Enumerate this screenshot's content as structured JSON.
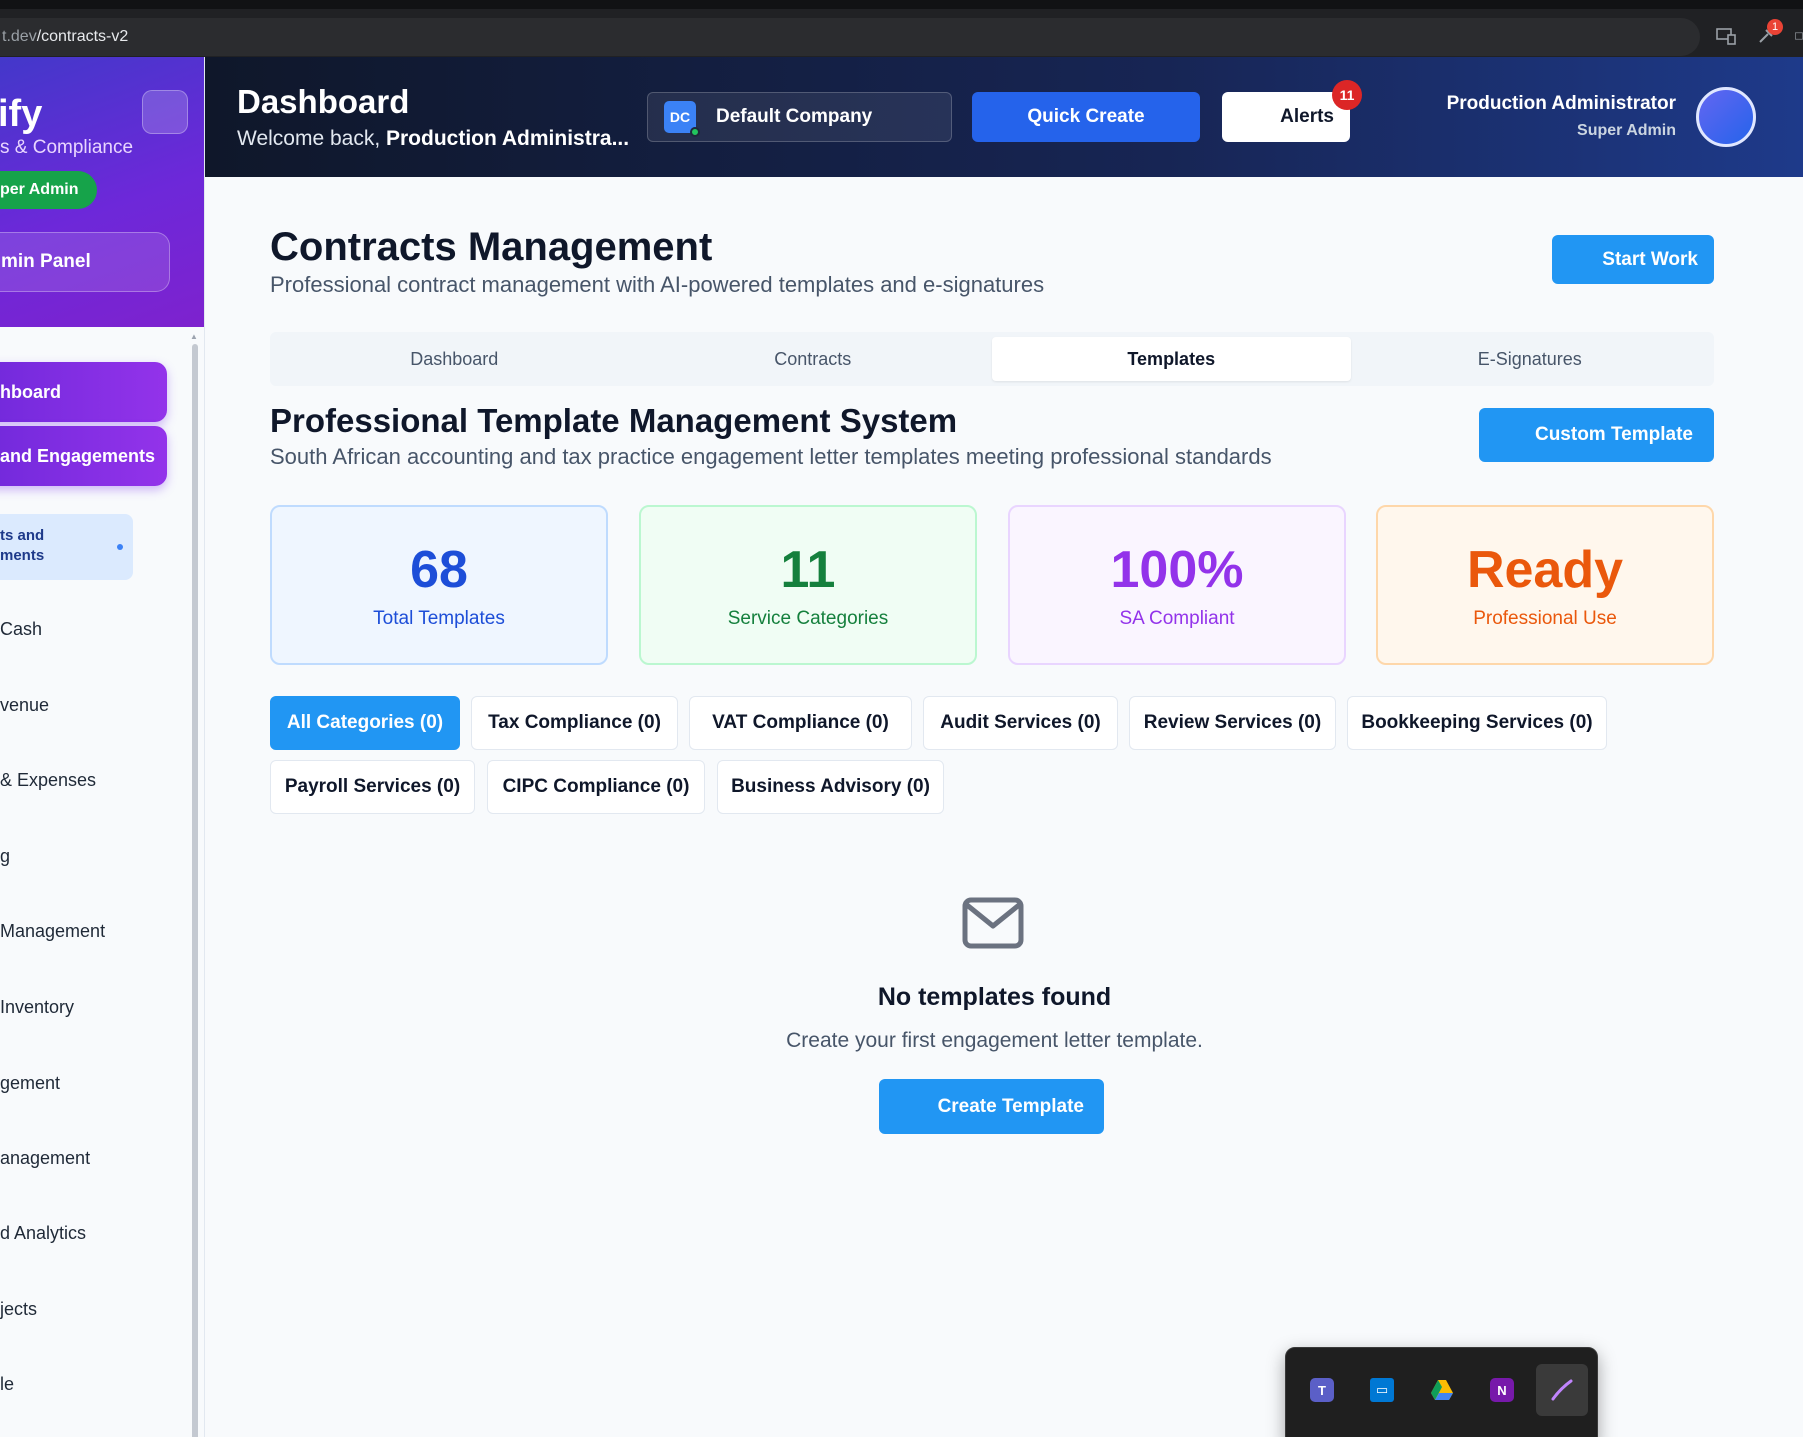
{
  "browser": {
    "url_prefix": "t.dev",
    "url_path": "/contracts-v2",
    "extension_badge": "1"
  },
  "sidebar": {
    "brand_name": "ify",
    "brand_subtitle": "s & Compliance",
    "role_pill": "per Admin",
    "admin_panel": "min Panel",
    "active_items": [
      {
        "label": "hboard"
      },
      {
        "label": "and Engagements"
      }
    ],
    "sub_item": {
      "line1": "ts and",
      "line2": "ments"
    },
    "items": [
      {
        "label": "Cash"
      },
      {
        "label": "venue"
      },
      {
        "label": "& Expenses"
      },
      {
        "label": "g"
      },
      {
        "label": "Management"
      },
      {
        "label": "Inventory"
      },
      {
        "label": "gement"
      },
      {
        "label": "anagement"
      },
      {
        "label": "d Analytics"
      },
      {
        "label": "jects"
      },
      {
        "label": "le"
      }
    ]
  },
  "header": {
    "title": "Dashboard",
    "welcome_prefix": "Welcome back, ",
    "welcome_name": "Production Administra...",
    "company_initials": "DC",
    "company_name": "Default Company",
    "quick_create": "Quick Create",
    "alerts_label": "Alerts",
    "alerts_count": "11",
    "user_name": "Production Administrator",
    "user_role": "Super Admin"
  },
  "page": {
    "title": "Contracts Management",
    "subtitle": "Professional contract management with AI-powered templates and e-signatures",
    "start_work": "Start Work",
    "tabs": [
      {
        "label": "Dashboard",
        "active": false
      },
      {
        "label": "Contracts",
        "active": false
      },
      {
        "label": "Templates",
        "active": true
      },
      {
        "label": "E-Signatures",
        "active": false
      }
    ]
  },
  "templates": {
    "title": "Professional Template Management System",
    "subtitle": "South African accounting and tax practice engagement letter templates meeting professional standards",
    "custom_template": "Custom Template",
    "stats": [
      {
        "value": "68",
        "label": "Total Templates",
        "color": "#1d4ed8",
        "bg": "#eff6ff",
        "border": "#bfdbfe"
      },
      {
        "value": "11",
        "label": "Service Categories",
        "color": "#15803d",
        "bg": "#f0fdf4",
        "border": "#bbf7d0"
      },
      {
        "value": "100%",
        "label": "SA Compliant",
        "color": "#9333ea",
        "bg": "#faf5ff",
        "border": "#e9d5ff"
      },
      {
        "value": "Ready",
        "label": "Professional Use",
        "color": "#ea580c",
        "bg": "#fff7ed",
        "border": "#fed7aa"
      }
    ],
    "filters": [
      {
        "label": "All Categories (0)",
        "active": true
      },
      {
        "label": "Tax Compliance (0)",
        "active": false
      },
      {
        "label": "VAT Compliance (0)",
        "active": false
      },
      {
        "label": "Audit Services (0)",
        "active": false
      },
      {
        "label": "Review Services (0)",
        "active": false
      },
      {
        "label": "Bookkeeping Services (0)",
        "active": false
      },
      {
        "label": "Payroll Services (0)",
        "active": false
      },
      {
        "label": "CIPC Compliance (0)",
        "active": false
      },
      {
        "label": "Business Advisory (0)",
        "active": false
      }
    ],
    "empty_icon": "envelope-icon",
    "empty_title": "No templates found",
    "empty_subtitle": "Create your first engagement letter template.",
    "create_template": "Create Template"
  },
  "tray": {
    "icons": [
      "teams-icon",
      "remote-desktop-icon",
      "google-drive-icon",
      "onenote-icon",
      "pen-icon"
    ]
  }
}
